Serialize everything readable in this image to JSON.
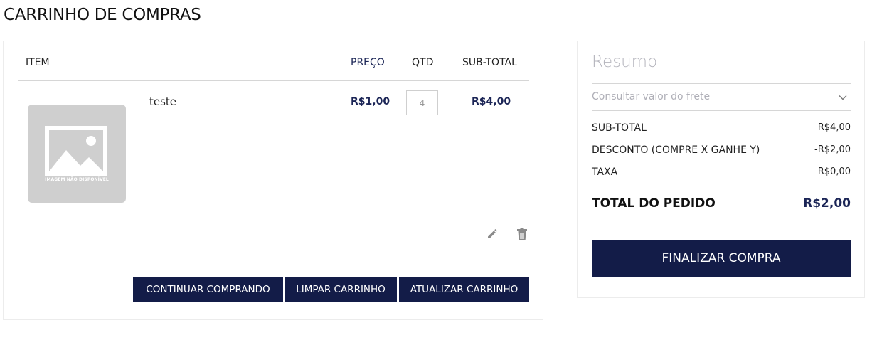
{
  "page": {
    "title": "CARRINHO DE COMPRAS"
  },
  "cart": {
    "headers": {
      "item": "ITEM",
      "price": "PREÇO",
      "qty": "QTD",
      "subtotal": "SUB-TOTAL"
    },
    "items": [
      {
        "name": "teste",
        "image_caption": "IMAGEM NÃO DISPONÍVEL",
        "price": "R$1,00",
        "qty": "4",
        "subtotal": "R$4,00"
      }
    ],
    "actions": {
      "continue_label": "CONTINUAR COMPRANDO",
      "clear_label": "LIMPAR CARRINHO",
      "update_label": "ATUALIZAR CARRINHO"
    },
    "row_icons": {
      "edit": "pencil-icon",
      "remove": "trash-icon"
    }
  },
  "summary": {
    "title": "Resumo",
    "shipping_label": "Consultar valor do frete",
    "lines": [
      {
        "label": "SUB-TOTAL",
        "value": "R$4,00"
      },
      {
        "label": "DESCONTO (COMPRE X GANHE Y)",
        "value": "-R$2,00"
      },
      {
        "label": "TAXA",
        "value": "R$0,00"
      }
    ],
    "total_label": "TOTAL DO PEDIDO",
    "total_value": "R$2,00",
    "checkout_label": "FINALIZAR COMPRA"
  },
  "colors": {
    "primary": "#131c48",
    "accent_text": "#1b2556",
    "muted": "#b5b5bd"
  }
}
